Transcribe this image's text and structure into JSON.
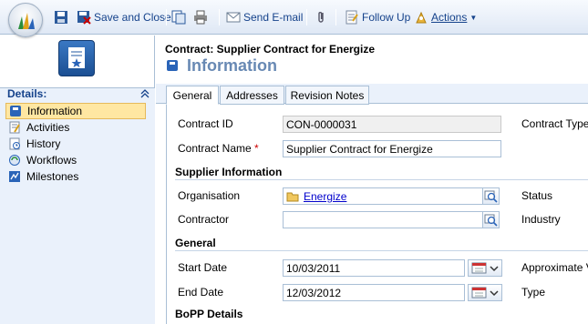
{
  "toolbar": {
    "save_close": "Save and Close",
    "send_email": "Send E-mail",
    "follow_up": "Follow Up",
    "actions": "Actions"
  },
  "nav": {
    "details_label": "Details:",
    "items": [
      {
        "label": "Information",
        "icon": "information-icon"
      },
      {
        "label": "Activities",
        "icon": "activities-icon"
      },
      {
        "label": "History",
        "icon": "history-icon"
      },
      {
        "label": "Workflows",
        "icon": "workflows-icon"
      },
      {
        "label": "Milestones",
        "icon": "milestones-icon"
      }
    ]
  },
  "header": {
    "subtitle": "Contract: Supplier Contract for Energize",
    "title": "Information"
  },
  "tabs": [
    "General",
    "Addresses",
    "Revision Notes"
  ],
  "form": {
    "contract_id_label": "Contract ID",
    "contract_id_value": "CON-0000031",
    "contract_type_label": "Contract Type",
    "contract_name_label": "Contract Name",
    "required_marker": "*",
    "contract_name_value": "Supplier Contract for Energize",
    "supplier_section": "Supplier Information",
    "organisation_label": "Organisation",
    "organisation_value": "Energize",
    "status_label": "Status",
    "contractor_label": "Contractor",
    "contractor_value": "",
    "industry_label": "Industry",
    "general_section": "General",
    "start_date_label": "Start Date",
    "start_date_value": "10/03/2011",
    "approx_label": "Approximate Va",
    "end_date_label": "End Date",
    "end_date_value": "12/03/2012",
    "type_label": "Type",
    "bopp_section": "BoPP Details"
  },
  "colors": {
    "accent": "#15428b",
    "title": "#6889b4",
    "selected_nav": "#ffe7a2",
    "required": "#cc0000"
  }
}
